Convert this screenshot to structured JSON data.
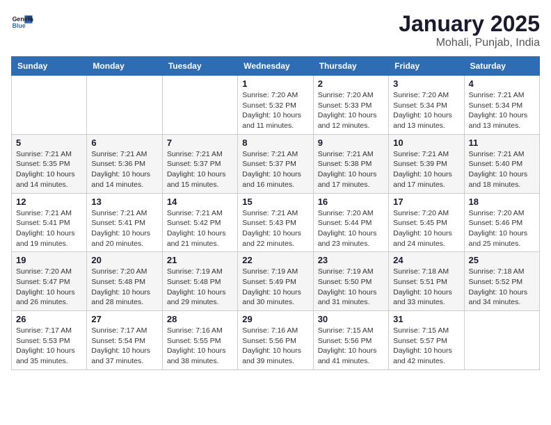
{
  "header": {
    "logo_line1": "General",
    "logo_line2": "Blue",
    "title": "January 2025",
    "subtitle": "Mohali, Punjab, India"
  },
  "days_of_week": [
    "Sunday",
    "Monday",
    "Tuesday",
    "Wednesday",
    "Thursday",
    "Friday",
    "Saturday"
  ],
  "weeks": [
    [
      {
        "day": "",
        "info": ""
      },
      {
        "day": "",
        "info": ""
      },
      {
        "day": "",
        "info": ""
      },
      {
        "day": "1",
        "info": "Sunrise: 7:20 AM\nSunset: 5:32 PM\nDaylight: 10 hours and 11 minutes."
      },
      {
        "day": "2",
        "info": "Sunrise: 7:20 AM\nSunset: 5:33 PM\nDaylight: 10 hours and 12 minutes."
      },
      {
        "day": "3",
        "info": "Sunrise: 7:20 AM\nSunset: 5:34 PM\nDaylight: 10 hours and 13 minutes."
      },
      {
        "day": "4",
        "info": "Sunrise: 7:21 AM\nSunset: 5:34 PM\nDaylight: 10 hours and 13 minutes."
      }
    ],
    [
      {
        "day": "5",
        "info": "Sunrise: 7:21 AM\nSunset: 5:35 PM\nDaylight: 10 hours and 14 minutes."
      },
      {
        "day": "6",
        "info": "Sunrise: 7:21 AM\nSunset: 5:36 PM\nDaylight: 10 hours and 14 minutes."
      },
      {
        "day": "7",
        "info": "Sunrise: 7:21 AM\nSunset: 5:37 PM\nDaylight: 10 hours and 15 minutes."
      },
      {
        "day": "8",
        "info": "Sunrise: 7:21 AM\nSunset: 5:37 PM\nDaylight: 10 hours and 16 minutes."
      },
      {
        "day": "9",
        "info": "Sunrise: 7:21 AM\nSunset: 5:38 PM\nDaylight: 10 hours and 17 minutes."
      },
      {
        "day": "10",
        "info": "Sunrise: 7:21 AM\nSunset: 5:39 PM\nDaylight: 10 hours and 17 minutes."
      },
      {
        "day": "11",
        "info": "Sunrise: 7:21 AM\nSunset: 5:40 PM\nDaylight: 10 hours and 18 minutes."
      }
    ],
    [
      {
        "day": "12",
        "info": "Sunrise: 7:21 AM\nSunset: 5:41 PM\nDaylight: 10 hours and 19 minutes."
      },
      {
        "day": "13",
        "info": "Sunrise: 7:21 AM\nSunset: 5:41 PM\nDaylight: 10 hours and 20 minutes."
      },
      {
        "day": "14",
        "info": "Sunrise: 7:21 AM\nSunset: 5:42 PM\nDaylight: 10 hours and 21 minutes."
      },
      {
        "day": "15",
        "info": "Sunrise: 7:21 AM\nSunset: 5:43 PM\nDaylight: 10 hours and 22 minutes."
      },
      {
        "day": "16",
        "info": "Sunrise: 7:20 AM\nSunset: 5:44 PM\nDaylight: 10 hours and 23 minutes."
      },
      {
        "day": "17",
        "info": "Sunrise: 7:20 AM\nSunset: 5:45 PM\nDaylight: 10 hours and 24 minutes."
      },
      {
        "day": "18",
        "info": "Sunrise: 7:20 AM\nSunset: 5:46 PM\nDaylight: 10 hours and 25 minutes."
      }
    ],
    [
      {
        "day": "19",
        "info": "Sunrise: 7:20 AM\nSunset: 5:47 PM\nDaylight: 10 hours and 26 minutes."
      },
      {
        "day": "20",
        "info": "Sunrise: 7:20 AM\nSunset: 5:48 PM\nDaylight: 10 hours and 28 minutes."
      },
      {
        "day": "21",
        "info": "Sunrise: 7:19 AM\nSunset: 5:48 PM\nDaylight: 10 hours and 29 minutes."
      },
      {
        "day": "22",
        "info": "Sunrise: 7:19 AM\nSunset: 5:49 PM\nDaylight: 10 hours and 30 minutes."
      },
      {
        "day": "23",
        "info": "Sunrise: 7:19 AM\nSunset: 5:50 PM\nDaylight: 10 hours and 31 minutes."
      },
      {
        "day": "24",
        "info": "Sunrise: 7:18 AM\nSunset: 5:51 PM\nDaylight: 10 hours and 33 minutes."
      },
      {
        "day": "25",
        "info": "Sunrise: 7:18 AM\nSunset: 5:52 PM\nDaylight: 10 hours and 34 minutes."
      }
    ],
    [
      {
        "day": "26",
        "info": "Sunrise: 7:17 AM\nSunset: 5:53 PM\nDaylight: 10 hours and 35 minutes."
      },
      {
        "day": "27",
        "info": "Sunrise: 7:17 AM\nSunset: 5:54 PM\nDaylight: 10 hours and 37 minutes."
      },
      {
        "day": "28",
        "info": "Sunrise: 7:16 AM\nSunset: 5:55 PM\nDaylight: 10 hours and 38 minutes."
      },
      {
        "day": "29",
        "info": "Sunrise: 7:16 AM\nSunset: 5:56 PM\nDaylight: 10 hours and 39 minutes."
      },
      {
        "day": "30",
        "info": "Sunrise: 7:15 AM\nSunset: 5:56 PM\nDaylight: 10 hours and 41 minutes."
      },
      {
        "day": "31",
        "info": "Sunrise: 7:15 AM\nSunset: 5:57 PM\nDaylight: 10 hours and 42 minutes."
      },
      {
        "day": "",
        "info": ""
      }
    ]
  ]
}
